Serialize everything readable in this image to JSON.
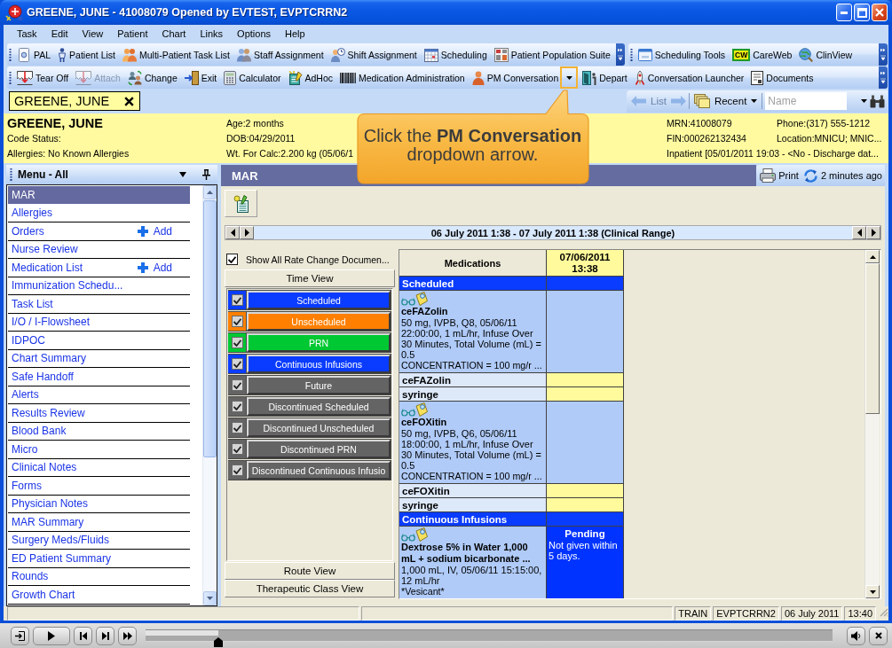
{
  "window": {
    "title": "GREENE, JUNE - 41008079 Opened by EVTEST, EVPTCRRN2"
  },
  "menu_bar": [
    "Task",
    "Edit",
    "View",
    "Patient",
    "Chart",
    "Links",
    "Options",
    "Help"
  ],
  "toolbar_row_1": [
    {
      "items": [
        {
          "label": "PAL"
        },
        {
          "label": "Patient List"
        },
        {
          "label": "Multi-Patient Task List"
        },
        {
          "label": "Staff Assignment"
        },
        {
          "label": "Shift Assignment"
        },
        {
          "label": "Scheduling"
        },
        {
          "label": "Patient Population Suite"
        }
      ]
    },
    {
      "items": [
        {
          "label": "Scheduling Tools"
        },
        {
          "label": "CareWeb",
          "logo": "CW"
        },
        {
          "label": "ClinView"
        }
      ]
    }
  ],
  "toolbar_row_2": [
    {
      "items": [
        {
          "label": "Tear Off",
          "kind": "button",
          "disabled": false,
          "highlighted": false
        },
        {
          "label": "Attach",
          "kind": "button",
          "disabled": true,
          "highlighted": false
        },
        {
          "label": "Change",
          "kind": "button",
          "disabled": false,
          "highlighted": false
        },
        {
          "label": "Exit",
          "kind": "button",
          "disabled": false,
          "highlighted": false
        },
        {
          "label": "Calculator",
          "kind": "button",
          "disabled": false,
          "highlighted": false
        },
        {
          "label": "AdHoc",
          "kind": "button",
          "disabled": false,
          "highlighted": false
        },
        {
          "label": "Medication Administration",
          "kind": "button",
          "disabled": false,
          "highlighted": false
        },
        {
          "label": "PM Conversation",
          "kind": "split",
          "disabled": false,
          "highlighted": true
        },
        {
          "label": "Depart",
          "kind": "button",
          "disabled": false,
          "highlighted": false
        },
        {
          "label": "Conversation Launcher",
          "kind": "button",
          "disabled": false,
          "highlighted": false
        },
        {
          "label": "Documents",
          "kind": "button",
          "disabled": false,
          "highlighted": false
        }
      ]
    }
  ],
  "patient_tab": {
    "label": "GREENE, JUNE"
  },
  "navigation": {
    "list": {
      "label": "List",
      "disabled": true
    },
    "recent": {
      "label": "Recent"
    },
    "search": {
      "placeholder": "Name"
    }
  },
  "banner": {
    "rows": [
      [
        "GREENE, JUNE",
        "Age:2 months",
        "MRN:41008079",
        "Phone:(317) 555-1212"
      ],
      [
        "Code Status:",
        "DOB:04/29/2011",
        "FIN:000262132434",
        "Location:MNICU; MNIC..."
      ],
      [
        "Allergies: No Known Allergies",
        "Wt. For Calc:2.200 kg (05/06/1",
        "Inpatient [05/01/2011 19:03 - <No - Discharge dat..."
      ]
    ]
  },
  "callout": {
    "text": "Click the **PM Conversation** dropdown arrow."
  },
  "side_menu": {
    "title": "Menu - All",
    "items": [
      {
        "label": "MAR",
        "selected": true
      },
      {
        "label": "Allergies",
        "selected": false
      },
      {
        "label": "Orders",
        "selected": false,
        "action": "Add"
      },
      {
        "label": "Nurse Review",
        "selected": false
      },
      {
        "label": "Medication List",
        "selected": false,
        "action": "Add"
      },
      {
        "label": "Immunization Schedu...",
        "selected": false
      },
      {
        "label": "Task List",
        "selected": false
      },
      {
        "label": "I/O / I-Flowsheet",
        "selected": false
      },
      {
        "label": "IDPOC",
        "selected": false
      },
      {
        "label": "Chart Summary",
        "selected": false
      },
      {
        "label": "Safe Handoff",
        "selected": false
      },
      {
        "label": "Alerts",
        "selected": false
      },
      {
        "label": "Results Review",
        "selected": false
      },
      {
        "label": "Blood Bank",
        "selected": false
      },
      {
        "label": "Micro",
        "selected": false
      },
      {
        "label": "Clinical Notes",
        "selected": false
      },
      {
        "label": "Forms",
        "selected": false
      },
      {
        "label": "Physician Notes",
        "selected": false
      },
      {
        "label": "MAR Summary",
        "selected": false
      },
      {
        "label": "Surgery Meds/Fluids",
        "selected": false
      },
      {
        "label": "ED Patient Summary",
        "selected": false
      },
      {
        "label": "Rounds",
        "selected": false
      },
      {
        "label": "Growth Chart",
        "selected": false
      }
    ]
  },
  "mar": {
    "title": "MAR",
    "print_label": "Print",
    "refresh_label": "2 minutes ago",
    "range": "06 July 2011 1:38 - 07 July 2011 1:38 (Clinical Range)",
    "show_all": {
      "label": "Show All Rate Change Documen...",
      "checked": true
    },
    "views": [
      {
        "label": "Time View",
        "filters": [
          {
            "label": "Scheduled",
            "color": "#0a3cff",
            "checked": true
          },
          {
            "label": "Unscheduled",
            "color": "#ff8000",
            "checked": true
          },
          {
            "label": "PRN",
            "color": "#00c832",
            "checked": true
          },
          {
            "label": "Continuous Infusions",
            "color": "#0a3cff",
            "checked": true
          },
          {
            "label": "Future",
            "color": "#646464",
            "checked": true
          },
          {
            "label": "Discontinued Scheduled",
            "color": "#646464",
            "checked": true
          },
          {
            "label": "Discontinued Unscheduled",
            "color": "#646464",
            "checked": true
          },
          {
            "label": "Discontinued PRN",
            "color": "#646464",
            "checked": true
          },
          {
            "label": "Discontinued Continuous Infusio",
            "color": "#646464",
            "checked": true
          }
        ]
      },
      {
        "label": "Route View"
      },
      {
        "label": "Therapeutic Class View"
      }
    ],
    "grid": {
      "columns": [
        "Medications",
        "07/06/2011 13:38"
      ],
      "rows": [
        {
          "kind": "group",
          "label": "Scheduled"
        },
        {
          "kind": "order",
          "name": "ceFAZolin",
          "details": "50 mg, IVPB, Q8, 05/06/11 22:00:00, 1 mL/hr, Infuse Over 30 Minutes, Total Volume (mL) = 0.5",
          "note": "CONCENTRATION = 100 mg/r ..."
        },
        {
          "kind": "component",
          "label": "ceFAZolin"
        },
        {
          "kind": "component",
          "label": "syringe"
        },
        {
          "kind": "order",
          "name": "ceFOXitin",
          "details": "50 mg, IVPB, Q6, 05/06/11 18:00:00, 1 mL/hr, Infuse Over 30 Minutes, Total Volume (mL) = 0.5",
          "note": "CONCENTRATION = 100 mg/r ..."
        },
        {
          "kind": "component",
          "label": "ceFOXitin"
        },
        {
          "kind": "component",
          "label": "syringe"
        },
        {
          "kind": "group",
          "label": "Continuous Infusions"
        },
        {
          "kind": "order",
          "name": "Dextrose 5% in Water 1,000 mL + sodium bicarbonate ...",
          "details": "1,000 mL, IV, 05/06/11 15:15:00, 12 mL/hr",
          "note": "*Vesicant*",
          "status": "Pending",
          "status_note": "Not given within 5 days."
        }
      ]
    }
  },
  "status_bar": [
    "TRAIN",
    "EVPTCRRN2",
    "06 July 2011",
    "13:40"
  ],
  "player": {
    "level": 0.106
  }
}
